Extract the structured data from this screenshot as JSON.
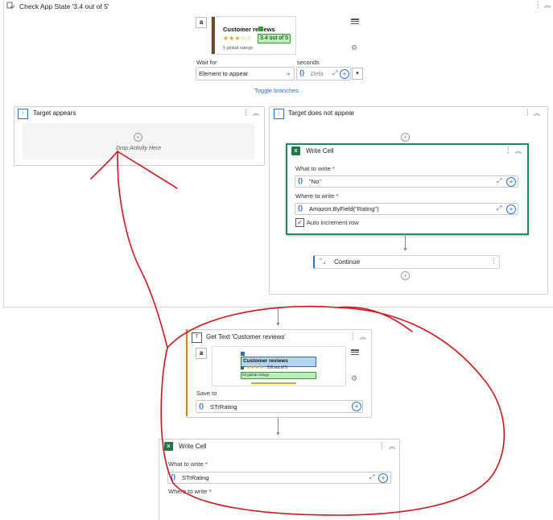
{
  "activity": {
    "title": "Check App State '3.4 out of 5'",
    "preview": {
      "heading": "Customer reviews",
      "rating_text": "3.4 out of 5",
      "ratings_caption": "5 global ratings"
    },
    "wait_for_label": "Wait for",
    "wait_for_value": "Element to appear",
    "seconds_label": "seconds",
    "seconds_placeholder": "Defa",
    "toggle_branches": "Toggle branches",
    "target_appears": {
      "title": "Target appears",
      "drop_hint": "Drop Activity Here"
    },
    "target_not_appear": {
      "title": "Target does not appear",
      "write_cell": {
        "title": "Write Cell",
        "what_label": "What to write",
        "what_value": "\"No\"",
        "where_label": "Where to write",
        "where_value": "Amazon.ByField(\"Rating\")",
        "auto_increment": "Auto increment row",
        "auto_increment_checked": true
      },
      "continue_label": "Continue"
    }
  },
  "get_text": {
    "title": "Get Text 'Customer reviews'",
    "preview": {
      "heading": "Customer reviews",
      "rating_text": "3.8 out of 5",
      "ratings_caption": "53 global ratings"
    },
    "save_to_label": "Save to",
    "save_to_value": "STrRating"
  },
  "write_cell_2": {
    "title": "Write Cell",
    "what_label": "What to write",
    "what_value": "STrRating",
    "where_label": "Where to write"
  },
  "colors": {
    "accent": "#2a6fd6",
    "excel_green": "#1d7a45",
    "selection_border": "#1f8a5e",
    "annotation_red": "#d0161b"
  }
}
